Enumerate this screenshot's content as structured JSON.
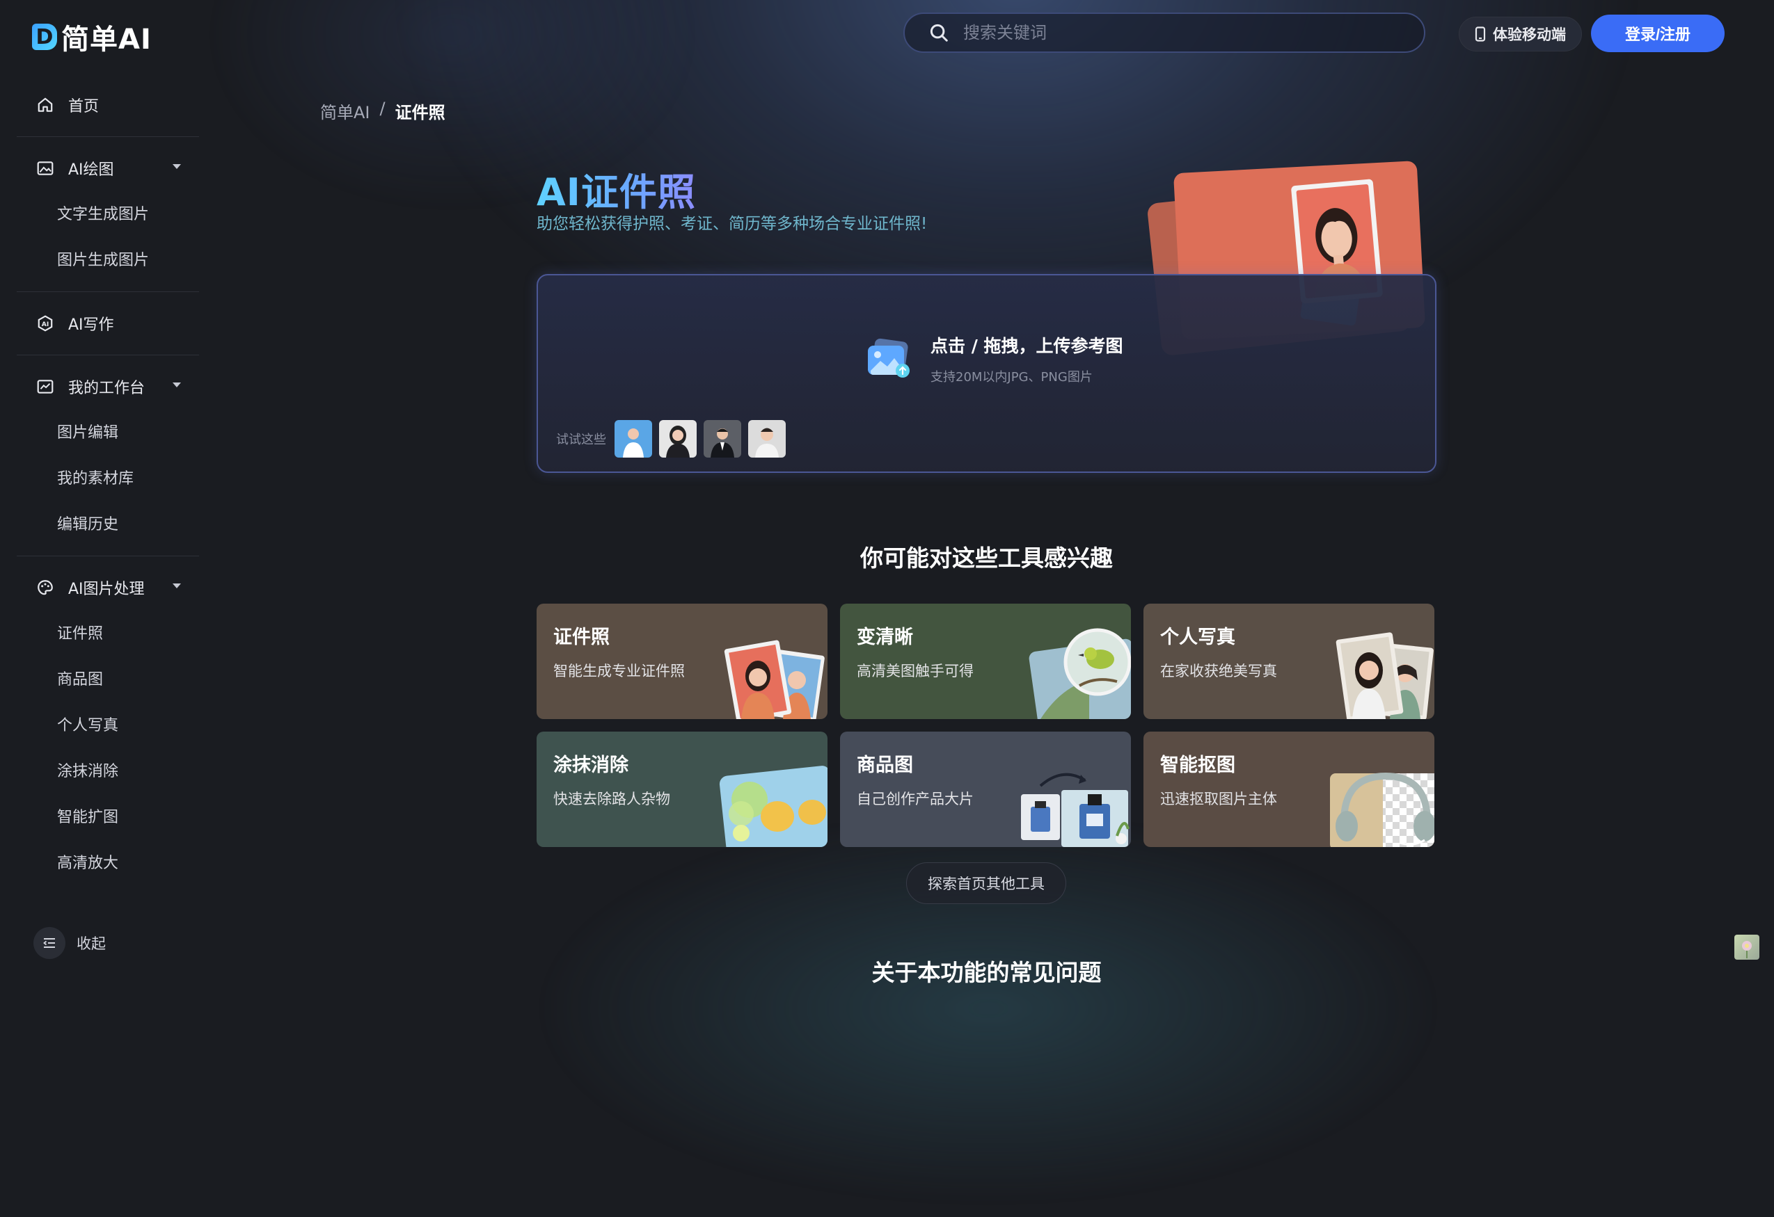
{
  "app": {
    "logo_text": "简单AI"
  },
  "header": {
    "search_placeholder": "搜索关键词",
    "mobile_label": "体验移动端",
    "login_label": "登录/注册"
  },
  "sidebar": {
    "home": "首页",
    "groups": [
      {
        "label": "AI绘图",
        "items": [
          "文字生成图片",
          "图片生成图片"
        ]
      },
      {
        "label": "AI写作",
        "items": []
      },
      {
        "label": "我的工作台",
        "items": [
          "图片编辑",
          "我的素材库",
          "编辑历史"
        ]
      },
      {
        "label": "AI图片处理",
        "items": [
          "证件照",
          "商品图",
          "个人写真",
          "涂抹消除",
          "智能扩图",
          "高清放大"
        ]
      }
    ],
    "collapse_label": "收起"
  },
  "breadcrumb": {
    "root": "简单AI",
    "separator": "/",
    "current": "证件照"
  },
  "hero": {
    "title": "AI证件照",
    "subtitle": "助您轻松获得护照、考证、简历等多种场合专业证件照!"
  },
  "upload": {
    "title": "点击 / 拖拽，上传参考图",
    "hint": "支持20M以内JPG、PNG图片",
    "try_label": "试试这些"
  },
  "tools": {
    "title": "你可能对这些工具感兴趣",
    "items": [
      {
        "name": "证件照",
        "desc": "智能生成专业证件照",
        "bg": "#5b4e44"
      },
      {
        "name": "变清晰",
        "desc": "高清美图触手可得",
        "bg": "#43553f"
      },
      {
        "name": "个人写真",
        "desc": "在家收获绝美写真",
        "bg": "#5a4f46"
      },
      {
        "name": "涂抹消除",
        "desc": "快速去除路人杂物",
        "bg": "#3f534f"
      },
      {
        "name": "商品图",
        "desc": "自己创作产品大片",
        "bg": "#464c59"
      },
      {
        "name": "智能抠图",
        "desc": "迅速抠取图片主体",
        "bg": "#5a4c44"
      }
    ],
    "explore_label": "探索首页其他工具"
  },
  "faq": {
    "title": "关于本功能的常见问题"
  }
}
